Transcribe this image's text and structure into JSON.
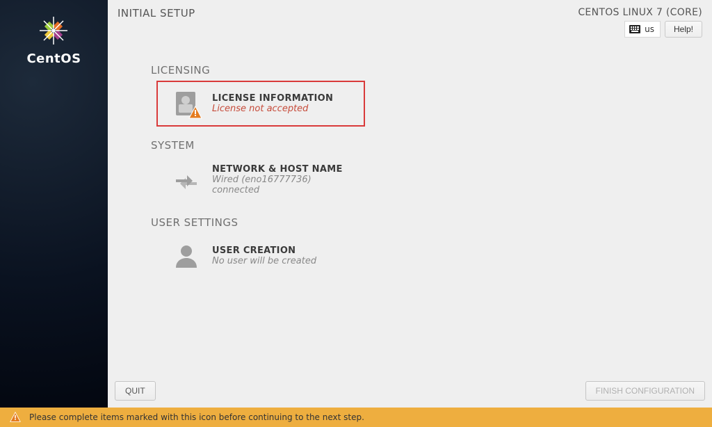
{
  "header": {
    "page_title": "INITIAL SETUP",
    "os_name": "CENTOS LINUX 7 (CORE)",
    "keyboard_layout": "us",
    "help_label": "Help!"
  },
  "sidebar": {
    "product_name": "CentOS"
  },
  "sections": {
    "licensing": {
      "title": "LICENSING",
      "spoke": {
        "title": "LICENSE INFORMATION",
        "subtitle": "License not accepted"
      }
    },
    "system": {
      "title": "SYSTEM",
      "spoke": {
        "title": "NETWORK & HOST NAME",
        "subtitle": "Wired (eno16777736) connected"
      }
    },
    "user_settings": {
      "title": "USER SETTINGS",
      "spoke": {
        "title": "USER CREATION",
        "subtitle": "No user will be created"
      }
    }
  },
  "footer": {
    "quit_label": "QUIT",
    "finish_label": "FINISH CONFIGURATION"
  },
  "warning_bar": {
    "message": "Please complete items marked with this icon before continuing to the next step."
  }
}
